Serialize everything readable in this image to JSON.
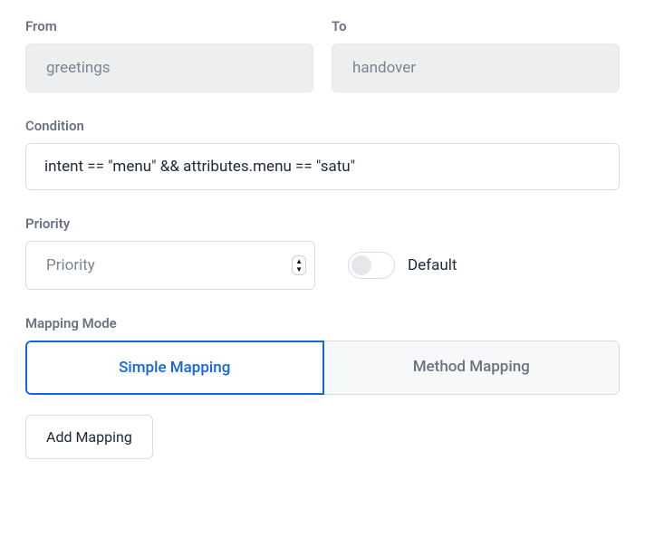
{
  "from": {
    "label": "From",
    "value": "greetings"
  },
  "to": {
    "label": "To",
    "value": "handover"
  },
  "condition": {
    "label": "Condition",
    "value": "intent == \"menu\" && attributes.menu == \"satu\""
  },
  "priority": {
    "label": "Priority",
    "placeholder": "Priority",
    "default_toggle_label": "Default",
    "default_toggle_on": false
  },
  "mapping_mode": {
    "label": "Mapping Mode",
    "tabs": [
      {
        "label": "Simple Mapping",
        "active": true
      },
      {
        "label": "Method Mapping",
        "active": false
      }
    ]
  },
  "add_mapping_label": "Add Mapping"
}
